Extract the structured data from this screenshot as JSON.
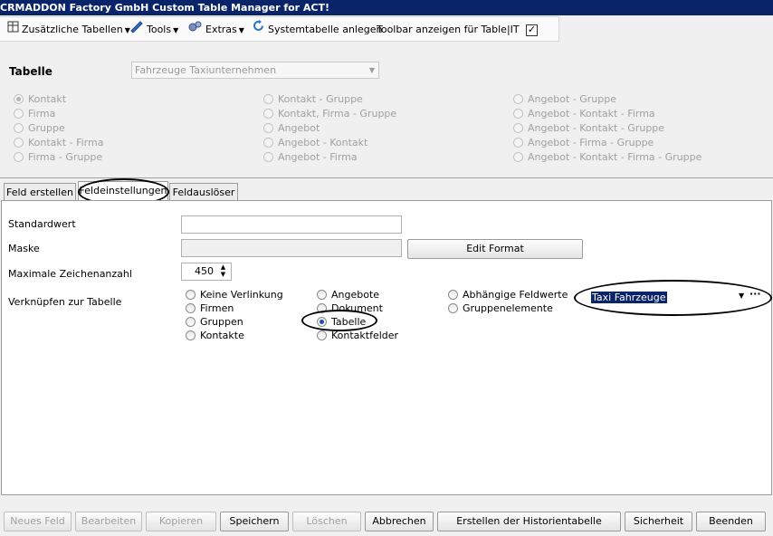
{
  "window": {
    "title": "CRMADDON Factory GmbH Custom Table Manager for ACT!"
  },
  "toolbar": {
    "tables_label": "Zusätzliche Tabellen",
    "tools_label": "Tools",
    "extras_label": "Extras",
    "systable_label": "Systemtabelle anlegen",
    "show_toolbar_label": "Toolbar anzeigen für Table|IT",
    "show_toolbar_checked": true
  },
  "table_section": {
    "label": "Tabelle",
    "selected": "Fahrzeuge Taxiunternehmen",
    "col1": [
      "Kontakt",
      "Firma",
      "Gruppe",
      "Kontakt - Firma",
      "Firma - Gruppe"
    ],
    "col2": [
      "Kontakt - Gruppe",
      "Kontakt, Firma - Gruppe",
      "Angebot",
      "Angebot - Kontakt",
      "Angebot - Firma"
    ],
    "col3": [
      "Angebot - Gruppe",
      "Angebot - Kontakt - Firma",
      "Angebot - Kontakt - Gruppe",
      "Angebot - Firma - Gruppe",
      "Angebot - Kontakt - Firma - Gruppe"
    ],
    "selected_option": "Kontakt"
  },
  "tabs": [
    "Feld erstellen",
    "Feldeinstellungen",
    "Feldauslöser"
  ],
  "active_tab": "Feldeinstellungen",
  "form": {
    "default_label": "Standardwert",
    "default_value": "",
    "mask_label": "Maske",
    "mask_value": "",
    "edit_format_label": "Edit Format",
    "maxchars_label": "Maximale Zeichenanzahl",
    "maxchars_value": "450",
    "link_label": "Verknüpfen zur Tabelle",
    "link_col1": [
      "Keine Verlinkung",
      "Firmen",
      "Gruppen",
      "Kontakte"
    ],
    "link_col2": [
      "Angebote",
      "Dokument",
      "Tabelle",
      "Kontaktfelder"
    ],
    "link_col3": [
      "Abhängige Feldwerte",
      "Gruppenelemente"
    ],
    "link_selected": "Tabelle",
    "table_dropdown_value": "Taxi Fahrzeuge"
  },
  "footer": {
    "new_field": "Neues Feld",
    "edit": "Bearbeiten",
    "copy": "Kopieren",
    "save": "Speichern",
    "delete": "Löschen",
    "cancel": "Abbrechen",
    "history": "Erstellen der Historientabelle",
    "security": "Sicherheit",
    "exit": "Beenden"
  }
}
